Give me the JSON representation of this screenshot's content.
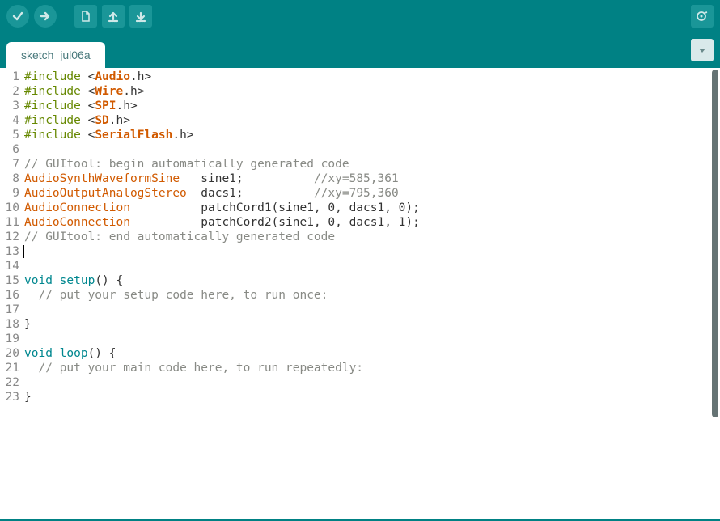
{
  "tab": {
    "name": "sketch_jul06a"
  },
  "code": {
    "lines": [
      {
        "n": 1,
        "segs": [
          {
            "t": "#include ",
            "c": "pre"
          },
          {
            "t": "<",
            "c": "punc"
          },
          {
            "t": "Audio",
            "c": "lib"
          },
          {
            "t": ".",
            "c": "punc"
          },
          {
            "t": "h",
            "c": "punc"
          },
          {
            "t": ">",
            "c": "punc"
          }
        ]
      },
      {
        "n": 2,
        "segs": [
          {
            "t": "#include ",
            "c": "pre"
          },
          {
            "t": "<",
            "c": "punc"
          },
          {
            "t": "Wire",
            "c": "lib"
          },
          {
            "t": ".",
            "c": "punc"
          },
          {
            "t": "h",
            "c": "punc"
          },
          {
            "t": ">",
            "c": "punc"
          }
        ]
      },
      {
        "n": 3,
        "segs": [
          {
            "t": "#include ",
            "c": "pre"
          },
          {
            "t": "<",
            "c": "punc"
          },
          {
            "t": "SPI",
            "c": "lib"
          },
          {
            "t": ".",
            "c": "punc"
          },
          {
            "t": "h",
            "c": "punc"
          },
          {
            "t": ">",
            "c": "punc"
          }
        ]
      },
      {
        "n": 4,
        "segs": [
          {
            "t": "#include ",
            "c": "pre"
          },
          {
            "t": "<",
            "c": "punc"
          },
          {
            "t": "SD",
            "c": "lib"
          },
          {
            "t": ".",
            "c": "punc"
          },
          {
            "t": "h",
            "c": "punc"
          },
          {
            "t": ">",
            "c": "punc"
          }
        ]
      },
      {
        "n": 5,
        "segs": [
          {
            "t": "#include ",
            "c": "pre"
          },
          {
            "t": "<",
            "c": "punc"
          },
          {
            "t": "SerialFlash",
            "c": "lib"
          },
          {
            "t": ".",
            "c": "punc"
          },
          {
            "t": "h",
            "c": "punc"
          },
          {
            "t": ">",
            "c": "punc"
          }
        ]
      },
      {
        "n": 6,
        "segs": []
      },
      {
        "n": 7,
        "segs": [
          {
            "t": "// GUItool: begin automatically generated code",
            "c": "cmt"
          }
        ]
      },
      {
        "n": 8,
        "segs": [
          {
            "t": "AudioSynthWaveformSine",
            "c": "type"
          },
          {
            "t": "   sine1;          ",
            "c": "punc"
          },
          {
            "t": "//xy=585,361",
            "c": "cmt"
          }
        ]
      },
      {
        "n": 9,
        "segs": [
          {
            "t": "AudioOutputAnalogStereo",
            "c": "type"
          },
          {
            "t": "  dacs1;          ",
            "c": "punc"
          },
          {
            "t": "//xy=795,360",
            "c": "cmt"
          }
        ]
      },
      {
        "n": 10,
        "segs": [
          {
            "t": "AudioConnection",
            "c": "type"
          },
          {
            "t": "          patchCord1(sine1, 0, dacs1, 0);",
            "c": "punc"
          }
        ]
      },
      {
        "n": 11,
        "segs": [
          {
            "t": "AudioConnection",
            "c": "type"
          },
          {
            "t": "          patchCord2(sine1, 0, dacs1, 1);",
            "c": "punc"
          }
        ]
      },
      {
        "n": 12,
        "segs": [
          {
            "t": "// GUItool: end automatically generated code",
            "c": "cmt"
          }
        ]
      },
      {
        "n": 13,
        "segs": [],
        "caret": true
      },
      {
        "n": 14,
        "segs": []
      },
      {
        "n": 15,
        "segs": [
          {
            "t": "void",
            "c": "kw"
          },
          {
            "t": " ",
            "c": "punc"
          },
          {
            "t": "setup",
            "c": "kw"
          },
          {
            "t": "() {",
            "c": "punc"
          }
        ]
      },
      {
        "n": 16,
        "segs": [
          {
            "t": "  ",
            "c": "punc"
          },
          {
            "t": "// put your setup code here, to run once:",
            "c": "cmt"
          }
        ]
      },
      {
        "n": 17,
        "segs": []
      },
      {
        "n": 18,
        "segs": [
          {
            "t": "}",
            "c": "punc"
          }
        ]
      },
      {
        "n": 19,
        "segs": []
      },
      {
        "n": 20,
        "segs": [
          {
            "t": "void",
            "c": "kw"
          },
          {
            "t": " ",
            "c": "punc"
          },
          {
            "t": "loop",
            "c": "kw"
          },
          {
            "t": "() {",
            "c": "punc"
          }
        ]
      },
      {
        "n": 21,
        "segs": [
          {
            "t": "  ",
            "c": "punc"
          },
          {
            "t": "// put your main code here, to run repeatedly:",
            "c": "cmt"
          }
        ]
      },
      {
        "n": 22,
        "segs": []
      },
      {
        "n": 23,
        "segs": [
          {
            "t": "}",
            "c": "punc"
          }
        ]
      }
    ]
  }
}
